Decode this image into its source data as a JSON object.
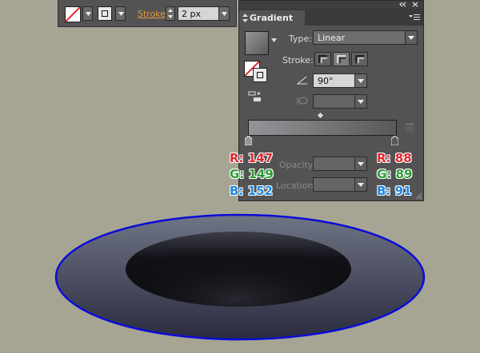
{
  "control_bar": {
    "stroke_label": "Stroke:",
    "stroke_weight": "2 px"
  },
  "gradient_panel": {
    "tab_title": "Gradient",
    "type_label": "Type:",
    "type_value": "Linear",
    "stroke_label": "Stroke:",
    "angle_value": "90°",
    "opacity_label": "Opacity:",
    "location_label": "Location:"
  },
  "color_callouts": {
    "left": {
      "r": "R: 147",
      "g": "G: 149",
      "b": "B: 152"
    },
    "right": {
      "r": "R: 88",
      "g": "G: 89",
      "b": "B: 91"
    }
  },
  "colors": {
    "background": "#a6a593",
    "panel": "#535353",
    "ellipse_stroke": "#0b0bd8",
    "gradient_start": "#939598",
    "gradient_end": "#58595b"
  },
  "icons": [
    "fill-none-icon",
    "stroke-swatch-icon",
    "gradient-preview-icon",
    "reverse-gradient-icon",
    "angle-icon",
    "aspect-ratio-icon",
    "trash-icon",
    "panel-menu-icon",
    "collapse-icon"
  ]
}
